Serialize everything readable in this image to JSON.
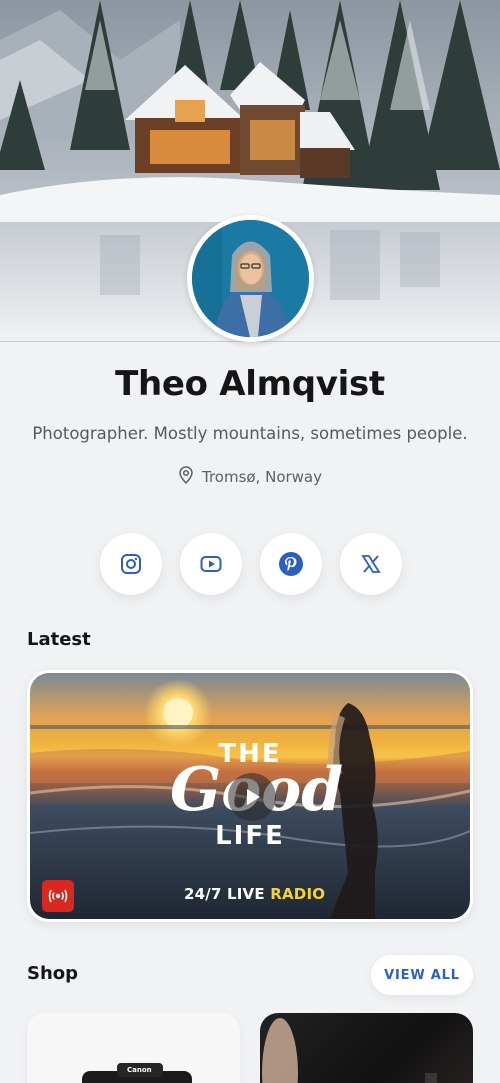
{
  "profile": {
    "name": "Theo Almqvist",
    "bio": "Photographer. Mostly mountains, sometimes people.",
    "location": "Tromsø, Norway"
  },
  "icons": {
    "location": "map-pin-icon",
    "socials": [
      "instagram-icon",
      "youtube-icon",
      "pinterest-icon",
      "x-icon"
    ],
    "play": "play-icon",
    "live": "broadcast-icon"
  },
  "sections": {
    "latest": "Latest",
    "shop": "Shop",
    "view_all": "VIEW ALL"
  },
  "video": {
    "title_line1": "THE",
    "title_line2": "Good",
    "title_line3": "LIFE",
    "radio_prefix": "24/7 LIVE",
    "radio_suffix": "RADIO"
  },
  "shop": {
    "camera_brand": "Canon"
  },
  "colors": {
    "accent": "#2d5fc0",
    "background": "#f1f2f4",
    "live_badge": "#d9281f"
  }
}
